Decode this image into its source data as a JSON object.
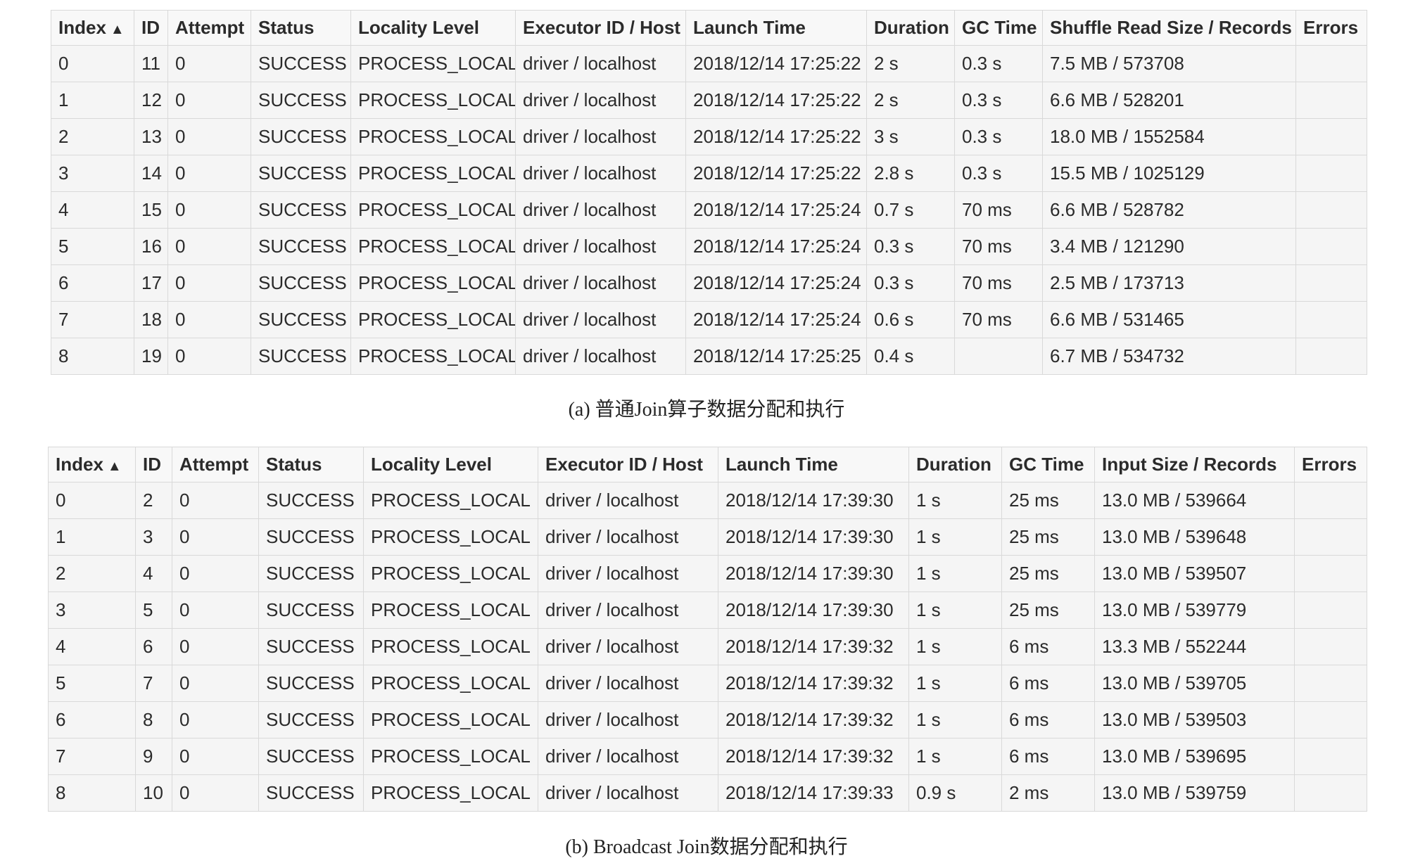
{
  "table_a": {
    "headers": [
      "Index",
      "ID",
      "Attempt",
      "Status",
      "Locality Level",
      "Executor ID / Host",
      "Launch Time",
      "Duration",
      "GC Time",
      "Shuffle Read Size / Records",
      "Errors"
    ],
    "sort_indicator": "▲",
    "rows": [
      [
        "0",
        "11",
        "0",
        "SUCCESS",
        "PROCESS_LOCAL",
        "driver / localhost",
        "2018/12/14 17:25:22",
        "2 s",
        "0.3 s",
        "7.5 MB / 573708",
        ""
      ],
      [
        "1",
        "12",
        "0",
        "SUCCESS",
        "PROCESS_LOCAL",
        "driver / localhost",
        "2018/12/14 17:25:22",
        "2 s",
        "0.3 s",
        "6.6 MB / 528201",
        ""
      ],
      [
        "2",
        "13",
        "0",
        "SUCCESS",
        "PROCESS_LOCAL",
        "driver / localhost",
        "2018/12/14 17:25:22",
        "3 s",
        "0.3 s",
        "18.0 MB / 1552584",
        ""
      ],
      [
        "3",
        "14",
        "0",
        "SUCCESS",
        "PROCESS_LOCAL",
        "driver / localhost",
        "2018/12/14 17:25:22",
        "2.8 s",
        "0.3 s",
        "15.5 MB / 1025129",
        ""
      ],
      [
        "4",
        "15",
        "0",
        "SUCCESS",
        "PROCESS_LOCAL",
        "driver / localhost",
        "2018/12/14 17:25:24",
        "0.7 s",
        "70 ms",
        "6.6 MB / 528782",
        ""
      ],
      [
        "5",
        "16",
        "0",
        "SUCCESS",
        "PROCESS_LOCAL",
        "driver / localhost",
        "2018/12/14 17:25:24",
        "0.3 s",
        "70 ms",
        "3.4 MB / 121290",
        ""
      ],
      [
        "6",
        "17",
        "0",
        "SUCCESS",
        "PROCESS_LOCAL",
        "driver / localhost",
        "2018/12/14 17:25:24",
        "0.3 s",
        "70 ms",
        "2.5 MB / 173713",
        ""
      ],
      [
        "7",
        "18",
        "0",
        "SUCCESS",
        "PROCESS_LOCAL",
        "driver / localhost",
        "2018/12/14 17:25:24",
        "0.6 s",
        "70 ms",
        "6.6 MB / 531465",
        ""
      ],
      [
        "8",
        "19",
        "0",
        "SUCCESS",
        "PROCESS_LOCAL",
        "driver / localhost",
        "2018/12/14 17:25:25",
        "0.4 s",
        "",
        "6.7 MB / 534732",
        ""
      ]
    ]
  },
  "caption_a": "(a) 普通Join算子数据分配和执行",
  "table_b": {
    "headers": [
      "Index",
      "ID",
      "Attempt",
      "Status",
      "Locality Level",
      "Executor ID / Host",
      "Launch Time",
      "Duration",
      "GC Time",
      "Input Size / Records",
      "Errors"
    ],
    "sort_indicator": "▲",
    "rows": [
      [
        "0",
        "2",
        "0",
        "SUCCESS",
        "PROCESS_LOCAL",
        "driver / localhost",
        "2018/12/14 17:39:30",
        "1 s",
        "25 ms",
        "13.0 MB / 539664",
        ""
      ],
      [
        "1",
        "3",
        "0",
        "SUCCESS",
        "PROCESS_LOCAL",
        "driver / localhost",
        "2018/12/14 17:39:30",
        "1 s",
        "25 ms",
        "13.0 MB / 539648",
        ""
      ],
      [
        "2",
        "4",
        "0",
        "SUCCESS",
        "PROCESS_LOCAL",
        "driver / localhost",
        "2018/12/14 17:39:30",
        "1 s",
        "25 ms",
        "13.0 MB / 539507",
        ""
      ],
      [
        "3",
        "5",
        "0",
        "SUCCESS",
        "PROCESS_LOCAL",
        "driver / localhost",
        "2018/12/14 17:39:30",
        "1 s",
        "25 ms",
        "13.0 MB / 539779",
        ""
      ],
      [
        "4",
        "6",
        "0",
        "SUCCESS",
        "PROCESS_LOCAL",
        "driver / localhost",
        "2018/12/14 17:39:32",
        "1 s",
        "6 ms",
        "13.3 MB / 552244",
        ""
      ],
      [
        "5",
        "7",
        "0",
        "SUCCESS",
        "PROCESS_LOCAL",
        "driver / localhost",
        "2018/12/14 17:39:32",
        "1 s",
        "6 ms",
        "13.0 MB / 539705",
        ""
      ],
      [
        "6",
        "8",
        "0",
        "SUCCESS",
        "PROCESS_LOCAL",
        "driver / localhost",
        "2018/12/14 17:39:32",
        "1 s",
        "6 ms",
        "13.0 MB / 539503",
        ""
      ],
      [
        "7",
        "9",
        "0",
        "SUCCESS",
        "PROCESS_LOCAL",
        "driver / localhost",
        "2018/12/14 17:39:32",
        "1 s",
        "6 ms",
        "13.0 MB / 539695",
        ""
      ],
      [
        "8",
        "10",
        "0",
        "SUCCESS",
        "PROCESS_LOCAL",
        "driver / localhost",
        "2018/12/14 17:39:33",
        "0.9 s",
        "2 ms",
        "13.0 MB / 539759",
        ""
      ]
    ]
  },
  "caption_b": "(b) Broadcast Join数据分配和执行"
}
